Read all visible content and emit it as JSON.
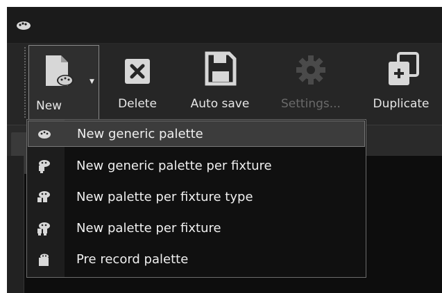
{
  "toolbar": {
    "new_label": "New",
    "delete_label": "Delete",
    "autosave_label": "Auto save",
    "settings_label": "Settings...",
    "duplicate_label": "Duplicate"
  },
  "menu": {
    "items": [
      {
        "label": "New generic palette",
        "icon": "palette-icon",
        "selected": true
      },
      {
        "label": "New generic palette per fixture",
        "icon": "palette-fixture-icon"
      },
      {
        "label": "New palette per fixture type",
        "icon": "palette-fixture-type-icon"
      },
      {
        "label": "New palette per fixture",
        "icon": "palette-per-fixture-icon"
      },
      {
        "label": "Pre record palette",
        "icon": "pre-record-icon"
      }
    ]
  },
  "colors": {
    "background": "#1f1f1f",
    "toolbar": "#262626",
    "menu_bg": "#101010",
    "menu_selected": "#3c3c3c",
    "text": "#e6e6e6",
    "disabled_text": "#6a6a6a"
  }
}
